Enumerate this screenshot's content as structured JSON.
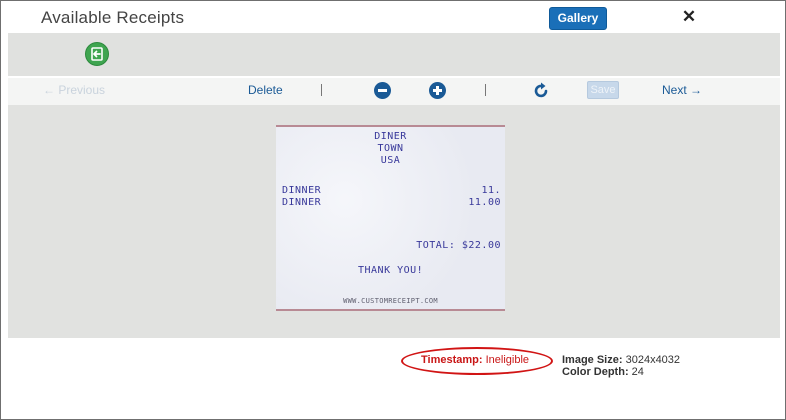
{
  "header": {
    "title": "Available Receipts",
    "gallery_label": "Gallery",
    "close_glyph": "✕"
  },
  "attach_bar": {
    "icon": "attach-receipt-icon",
    "icon_color": "#3fa550"
  },
  "toolbar": {
    "previous_label": "← Previous",
    "delete_label": "Delete",
    "zoom_out_icon": "minus-circle-icon",
    "zoom_in_icon": "plus-circle-icon",
    "rotate_icon": "rotate-icon",
    "save_label": "Save",
    "next_label": "Next →",
    "accent": "#1a5a96"
  },
  "receipt": {
    "header_lines": [
      "DINER",
      "TOWN",
      "USA"
    ],
    "items": [
      {
        "name": "DINNER",
        "amount": "11."
      },
      {
        "name": "DINNER",
        "amount": "11.00"
      }
    ],
    "total": "TOTAL: $22.00",
    "thanks": "THANK YOU!",
    "footer": "WWW.CUSTOMRECEIPT.COM"
  },
  "info": {
    "timestamp_label": "Timestamp:",
    "timestamp_value": "Ineligible",
    "image_size_label": "Image Size:",
    "image_size_value": "3024x4032",
    "color_depth_label": "Color Depth:",
    "color_depth_value": "24",
    "highlight_color": "#d11414"
  }
}
